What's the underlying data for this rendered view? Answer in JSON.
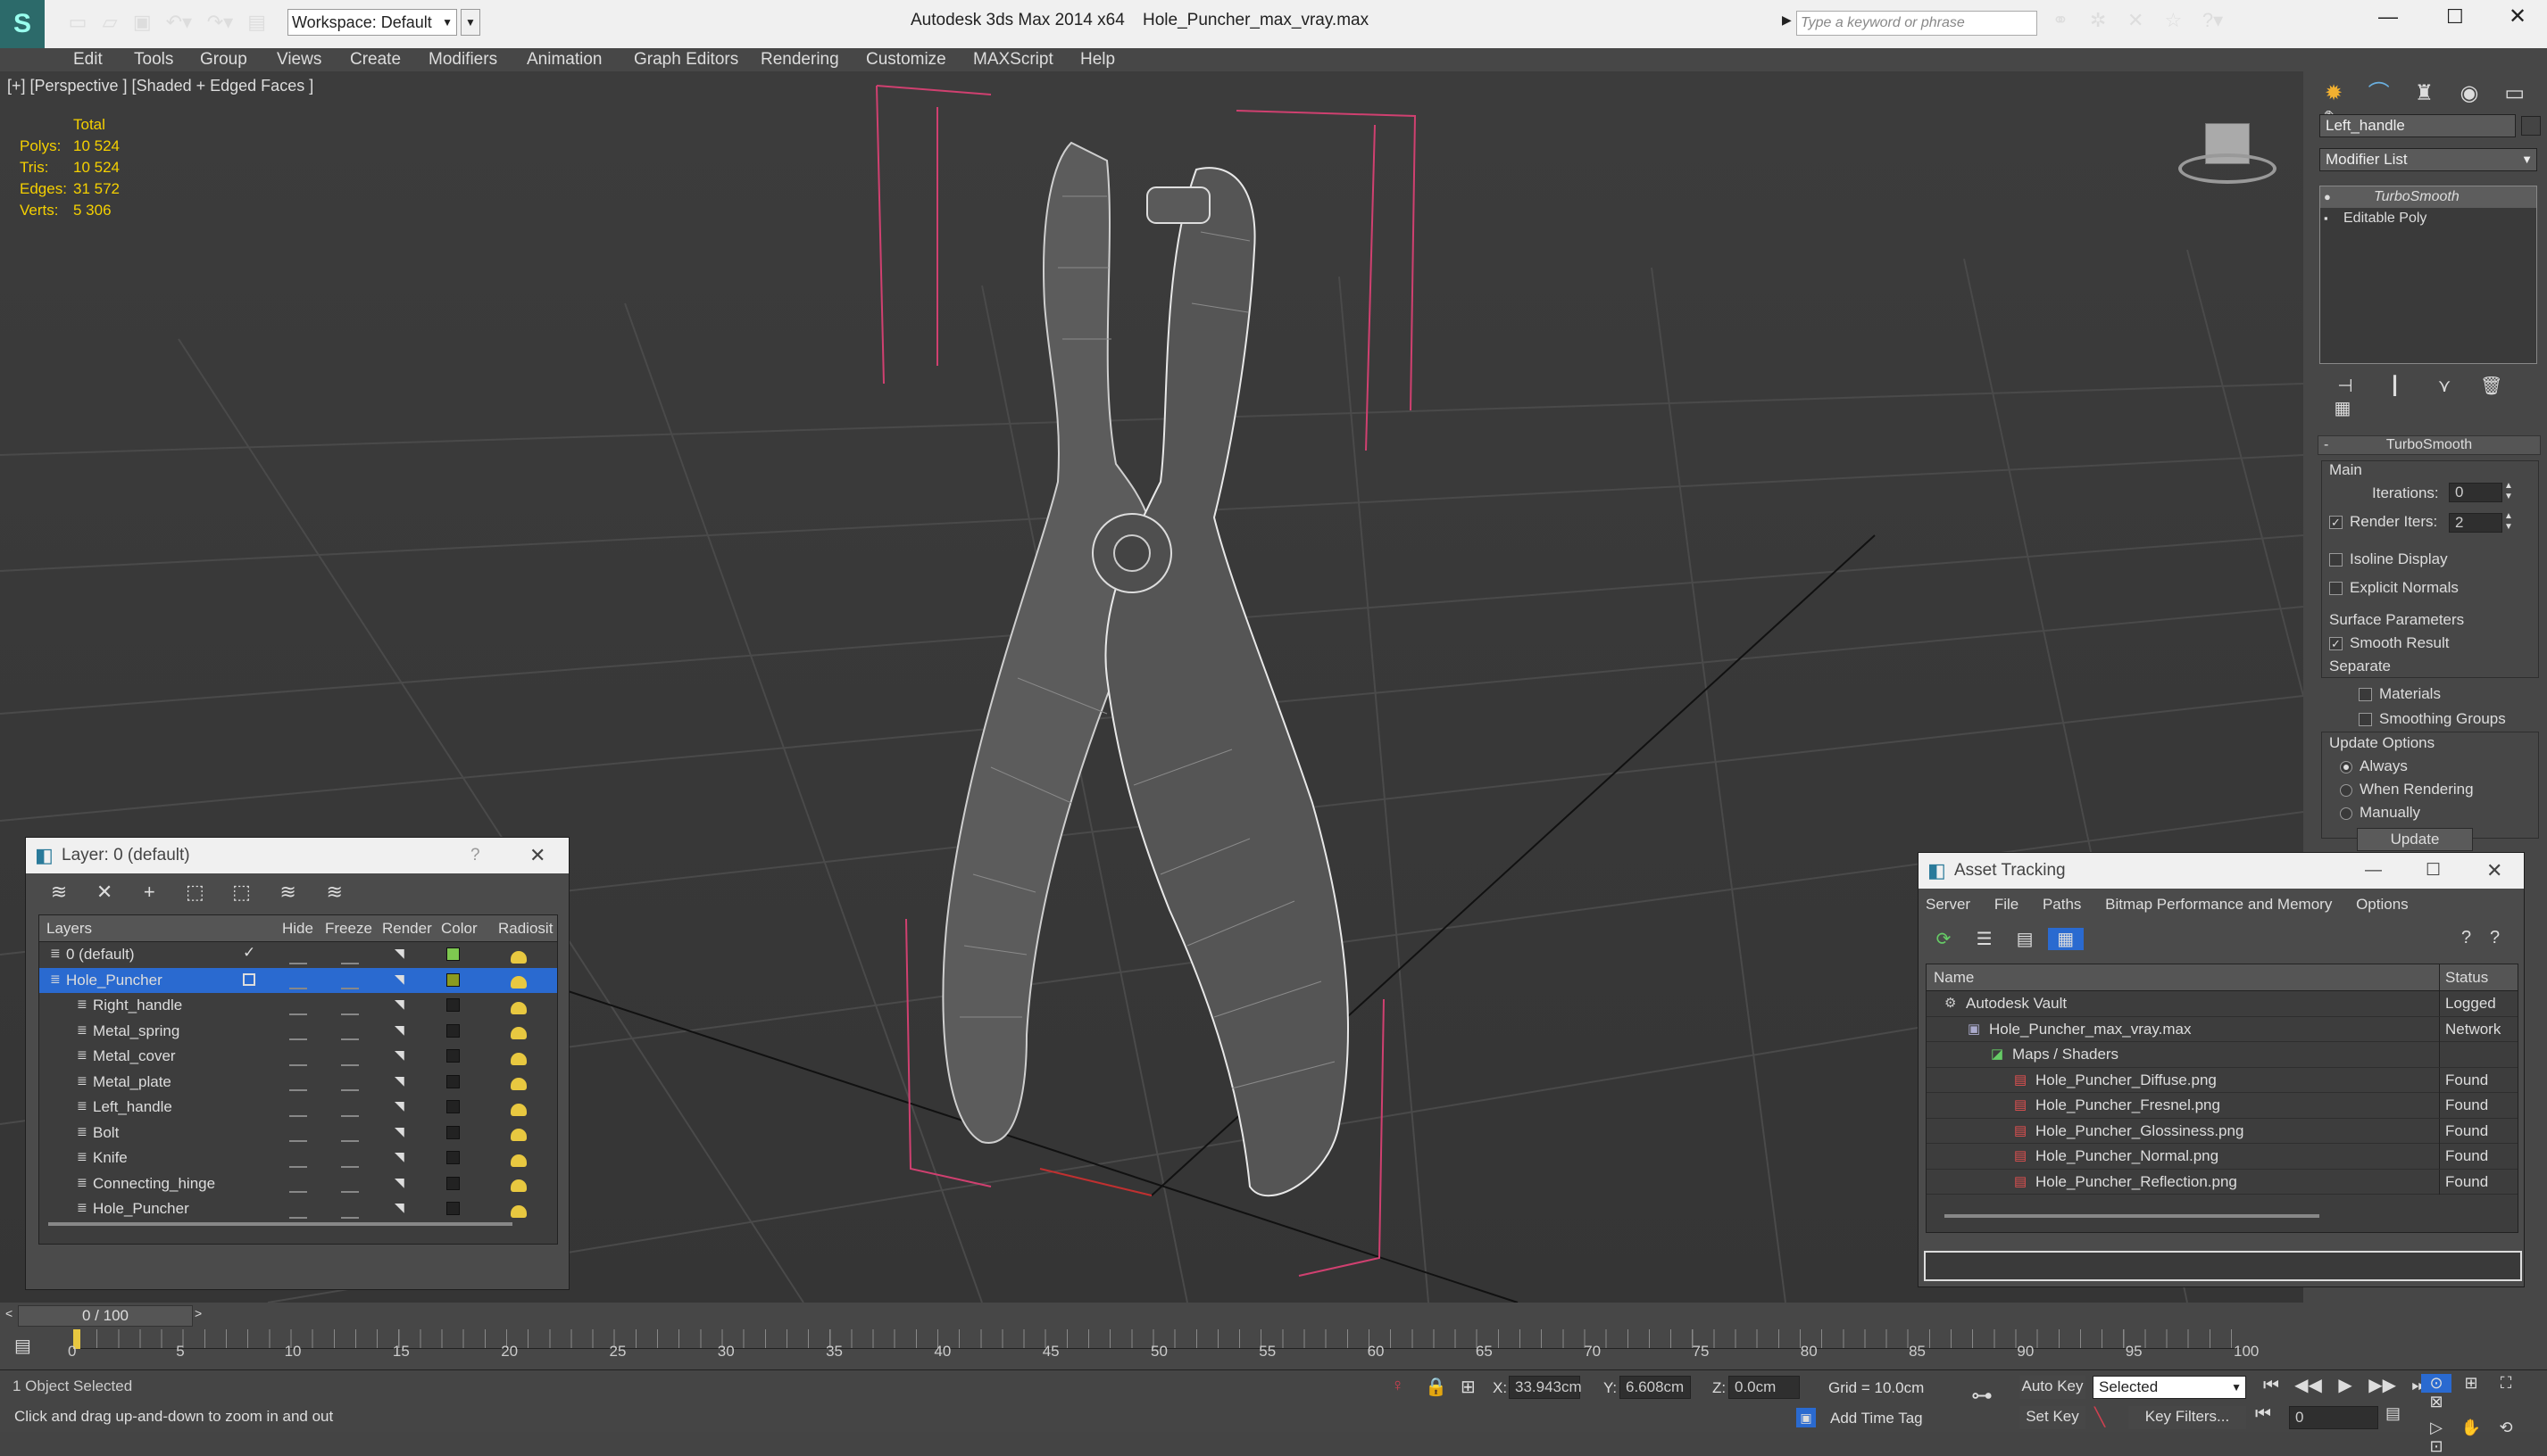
{
  "titlebar": {
    "workspace_label": "Workspace: Default",
    "app_title": "Autodesk 3ds Max  2014 x64",
    "file_title": "Hole_Puncher_max_vray.max",
    "search_placeholder": "Type a keyword or phrase"
  },
  "menu": [
    "Edit",
    "Tools",
    "Group",
    "Views",
    "Create",
    "Modifiers",
    "Animation",
    "Graph Editors",
    "Rendering",
    "Customize",
    "MAXScript",
    "Help"
  ],
  "viewport": {
    "label": "[+] [Perspective ] [Shaded + Edged Faces ]",
    "stats_header": "Total",
    "stats": [
      {
        "label": "Polys:",
        "value": "10 524"
      },
      {
        "label": "Tris:",
        "value": "10 524"
      },
      {
        "label": "Edges:",
        "value": "31 572"
      },
      {
        "label": "Verts:",
        "value": "5 306"
      }
    ]
  },
  "command_panel": {
    "object_name": "Left_handle",
    "modifier_list": "Modifier List",
    "stack": [
      "TurboSmooth",
      "Editable Poly"
    ],
    "rollout_title": "TurboSmooth",
    "main_label": "Main",
    "iterations_label": "Iterations:",
    "iterations_value": "0",
    "render_iters_label": "Render Iters:",
    "render_iters_value": "2",
    "isoline": "Isoline Display",
    "explicit_normals": "Explicit Normals",
    "surface_params": "Surface Parameters",
    "smooth_result": "Smooth Result",
    "separate": "Separate",
    "materials": "Materials",
    "smoothing_groups": "Smoothing Groups",
    "update_options": "Update Options",
    "always": "Always",
    "when_rendering": "When Rendering",
    "manually": "Manually",
    "update_button": "Update"
  },
  "layer_dialog": {
    "title": "Layer: 0 (default)",
    "help": "?",
    "columns": [
      "Layers",
      "Hide",
      "Freeze",
      "Render",
      "Color",
      "Radiosit"
    ],
    "rows": [
      {
        "name": "0 (default)",
        "color": "#7ec850",
        "level": 0
      },
      {
        "name": "Hole_Puncher",
        "color": "#8a9a20",
        "level": 0
      },
      {
        "name": "Right_handle",
        "color": "#222222",
        "level": 1
      },
      {
        "name": "Metal_spring",
        "color": "#222222",
        "level": 1
      },
      {
        "name": "Metal_cover",
        "color": "#222222",
        "level": 1
      },
      {
        "name": "Metal_plate",
        "color": "#222222",
        "level": 1
      },
      {
        "name": "Left_handle",
        "color": "#222222",
        "level": 1
      },
      {
        "name": "Bolt",
        "color": "#222222",
        "level": 1
      },
      {
        "name": "Knife",
        "color": "#222222",
        "level": 1
      },
      {
        "name": "Connecting_hinge",
        "color": "#222222",
        "level": 1
      },
      {
        "name": "Hole_Puncher",
        "color": "#222222",
        "level": 1
      }
    ]
  },
  "asset_dialog": {
    "title": "Asset Tracking",
    "menu": [
      "Server",
      "File",
      "Paths",
      "Bitmap Performance and Memory",
      "Options"
    ],
    "col_name": "Name",
    "col_status": "Status",
    "rows": [
      {
        "name": "Autodesk Vault",
        "status": "Logged Ou",
        "level": 0
      },
      {
        "name": "Hole_Puncher_max_vray.max",
        "status": "Network Pa",
        "level": 1
      },
      {
        "name": "Maps / Shaders",
        "status": "",
        "level": 2
      },
      {
        "name": "Hole_Puncher_Diffuse.png",
        "status": "Found",
        "level": 3
      },
      {
        "name": "Hole_Puncher_Fresnel.png",
        "status": "Found",
        "level": 3
      },
      {
        "name": "Hole_Puncher_Glossiness.png",
        "status": "Found",
        "level": 3
      },
      {
        "name": "Hole_Puncher_Normal.png",
        "status": "Found",
        "level": 3
      },
      {
        "name": "Hole_Puncher_Reflection.png",
        "status": "Found",
        "level": 3
      }
    ]
  },
  "timeline": {
    "frame_counter": "0 / 100",
    "ticks": [
      "0",
      "5",
      "10",
      "15",
      "20",
      "25",
      "30",
      "35",
      "40",
      "45",
      "50",
      "55",
      "60",
      "65",
      "70",
      "75",
      "80",
      "85",
      "90",
      "95",
      "100"
    ]
  },
  "status": {
    "selection": "1 Object Selected",
    "prompt": "Click and drag up-and-down to zoom in and out",
    "x_label": "X:",
    "x_value": "33.943cm",
    "y_label": "Y:",
    "y_value": "6.608cm",
    "z_label": "Z:",
    "z_value": "0.0cm",
    "grid": "Grid = 10.0cm",
    "auto_key": "Auto Key",
    "selected_dropdown": "Selected",
    "set_key": "Set Key",
    "key_filters": "Key Filters...",
    "add_time_tag": "Add Time Tag",
    "frame_value": "0"
  }
}
